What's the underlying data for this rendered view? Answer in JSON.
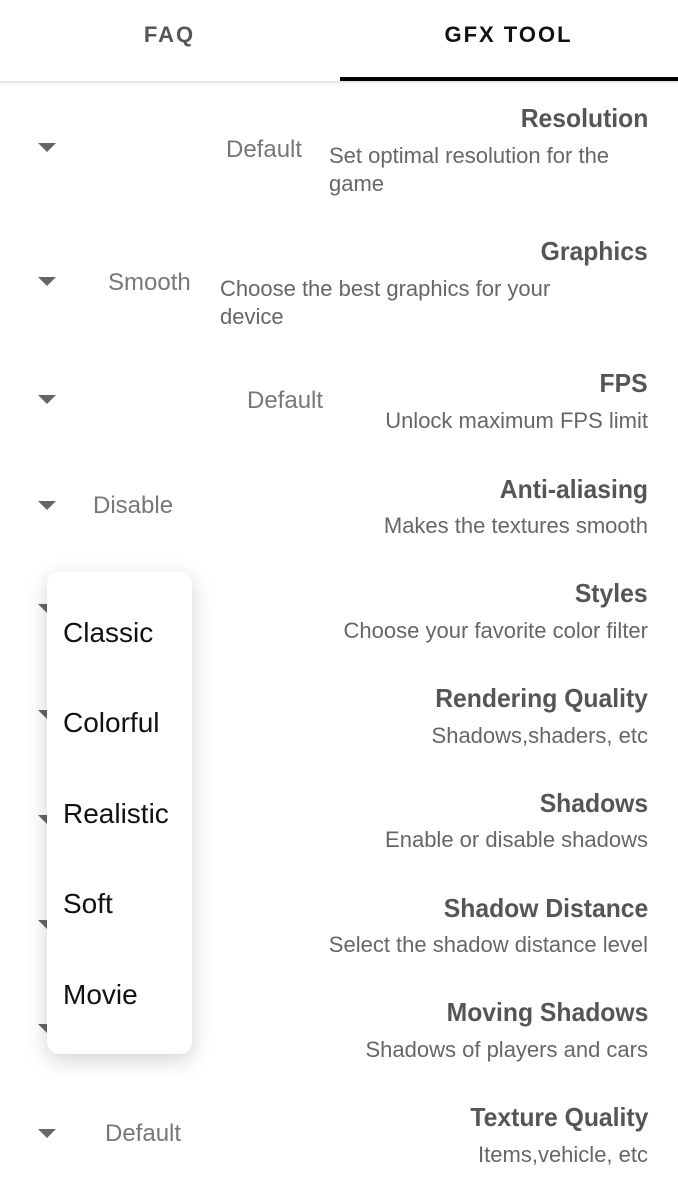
{
  "tabs": {
    "faq": "FAQ",
    "gfx": "GFX TOOL",
    "active": "GFX TOOL"
  },
  "settings": [
    {
      "title": "Resolution",
      "desc": "Set optimal resolution for the game",
      "value": "Default"
    },
    {
      "title": "Graphics",
      "desc": "Choose the best graphics for your device",
      "value": "Smooth"
    },
    {
      "title": "FPS",
      "desc": "Unlock maximum FPS limit",
      "value": "Default"
    },
    {
      "title": "Anti-aliasing",
      "desc": "Makes the textures smooth",
      "value": "Disable"
    },
    {
      "title": "Styles",
      "desc": "Choose your favorite color filter"
    },
    {
      "title": "Rendering Quality",
      "desc": "Shadows,shaders, etc"
    },
    {
      "title": "Shadows",
      "desc": "Enable or disable shadows"
    },
    {
      "title": "Shadow Distance",
      "desc": "Select the shadow distance level"
    },
    {
      "title": "Moving Shadows",
      "desc": "Shadows of players and cars"
    },
    {
      "title": "Texture Quality",
      "desc": "Items,vehicle, etc",
      "value": "Default"
    }
  ],
  "styles_dropdown": {
    "options": [
      "Classic",
      "Colorful",
      "Realistic",
      "Soft",
      "Movie"
    ]
  }
}
